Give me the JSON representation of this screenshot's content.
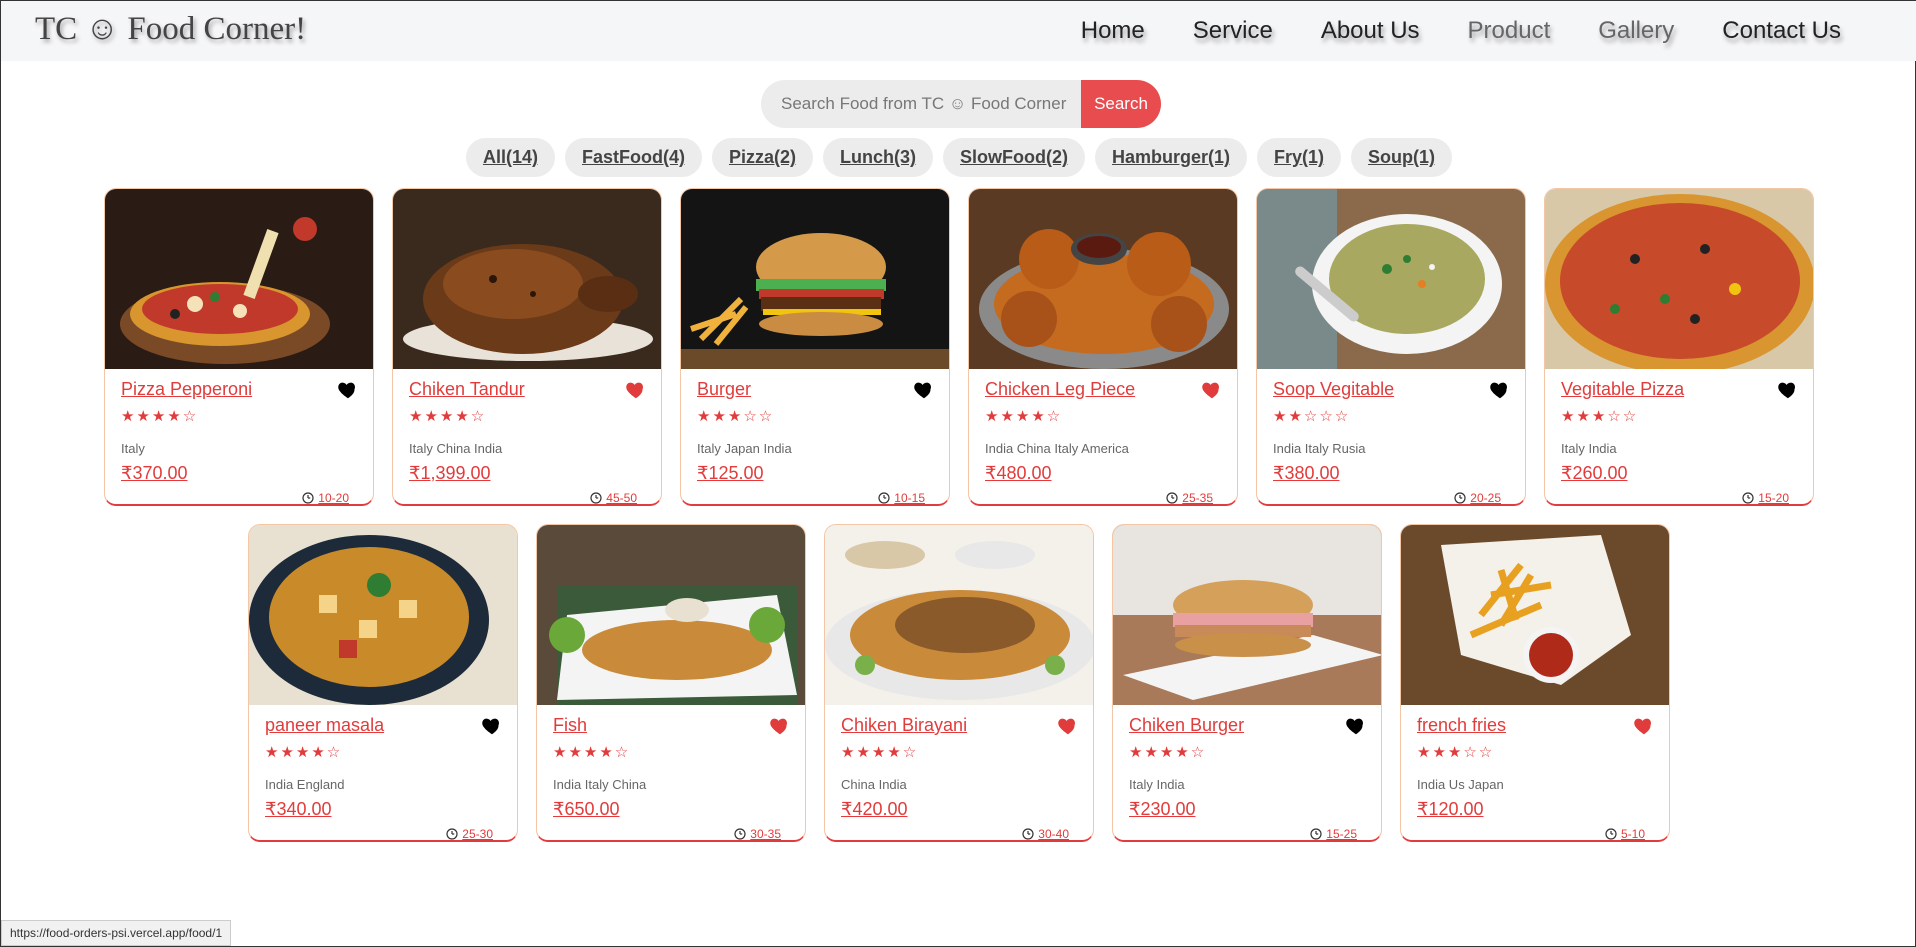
{
  "header": {
    "logo": "TC ☺ Food Corner!",
    "nav": [
      "Home",
      "Service",
      "About Us",
      "Product",
      "Gallery",
      "Contact Us"
    ]
  },
  "search": {
    "placeholder": "Search Food from TC ☺ Food Corner",
    "button": "Search"
  },
  "tags": [
    "All(14)",
    "FastFood(4)",
    "Pizza(2)",
    "Lunch(3)",
    "SlowFood(2)",
    "Hamburger(1)",
    "Fry(1)",
    "Soup(1)"
  ],
  "foods": [
    {
      "name": "Pizza Pepperoni",
      "stars": "★★★★☆",
      "origins": "Italy",
      "price": "₹370.00",
      "time": "10-20",
      "favorite": false,
      "image": "pizza"
    },
    {
      "name": "Chiken Tandur",
      "stars": "★★★★☆",
      "origins": "Italy China India",
      "price": "₹1,399.00",
      "time": "45-50",
      "favorite": true,
      "image": "roast-chicken"
    },
    {
      "name": "Burger",
      "stars": "★★★☆☆",
      "origins": "Italy Japan India",
      "price": "₹125.00",
      "time": "10-15",
      "favorite": false,
      "image": "burger"
    },
    {
      "name": "Chicken Leg Piece",
      "stars": "★★★★☆",
      "origins": "India China Italy America",
      "price": "₹480.00",
      "time": "25-35",
      "favorite": true,
      "image": "fried-chicken"
    },
    {
      "name": "Soop Vegitable",
      "stars": "★★☆☆☆",
      "origins": "India Italy Rusia",
      "price": "₹380.00",
      "time": "20-25",
      "favorite": false,
      "image": "soup"
    },
    {
      "name": "Vegitable Pizza",
      "stars": "★★★☆☆",
      "origins": "Italy India",
      "price": "₹260.00",
      "time": "15-20",
      "favorite": false,
      "image": "veg-pizza"
    },
    {
      "name": "paneer masala",
      "stars": "★★★★☆",
      "origins": "India England",
      "price": "₹340.00",
      "time": "25-30",
      "favorite": false,
      "image": "paneer"
    },
    {
      "name": "Fish",
      "stars": "★★★★☆",
      "origins": "India Italy China",
      "price": "₹650.00",
      "time": "30-35",
      "favorite": true,
      "image": "fish"
    },
    {
      "name": "Chiken Birayani",
      "stars": "★★★★☆",
      "origins": "China India",
      "price": "₹420.00",
      "time": "30-40",
      "favorite": true,
      "image": "biryani"
    },
    {
      "name": "Chiken Burger",
      "stars": "★★★★☆",
      "origins": "Italy India",
      "price": "₹230.00",
      "time": "15-25",
      "favorite": false,
      "image": "chicken-burger"
    },
    {
      "name": "french fries",
      "stars": "★★★☆☆",
      "origins": "India Us Japan",
      "price": "₹120.00",
      "time": "5-10",
      "favorite": true,
      "image": "fries"
    }
  ],
  "status_bar": {
    "url": "https://food-orders-psi.vercel.app/food/1"
  },
  "colors": {
    "accent": "#e84c4f",
    "heart_active": "#e23b3b",
    "heart_inactive": "#000000"
  }
}
